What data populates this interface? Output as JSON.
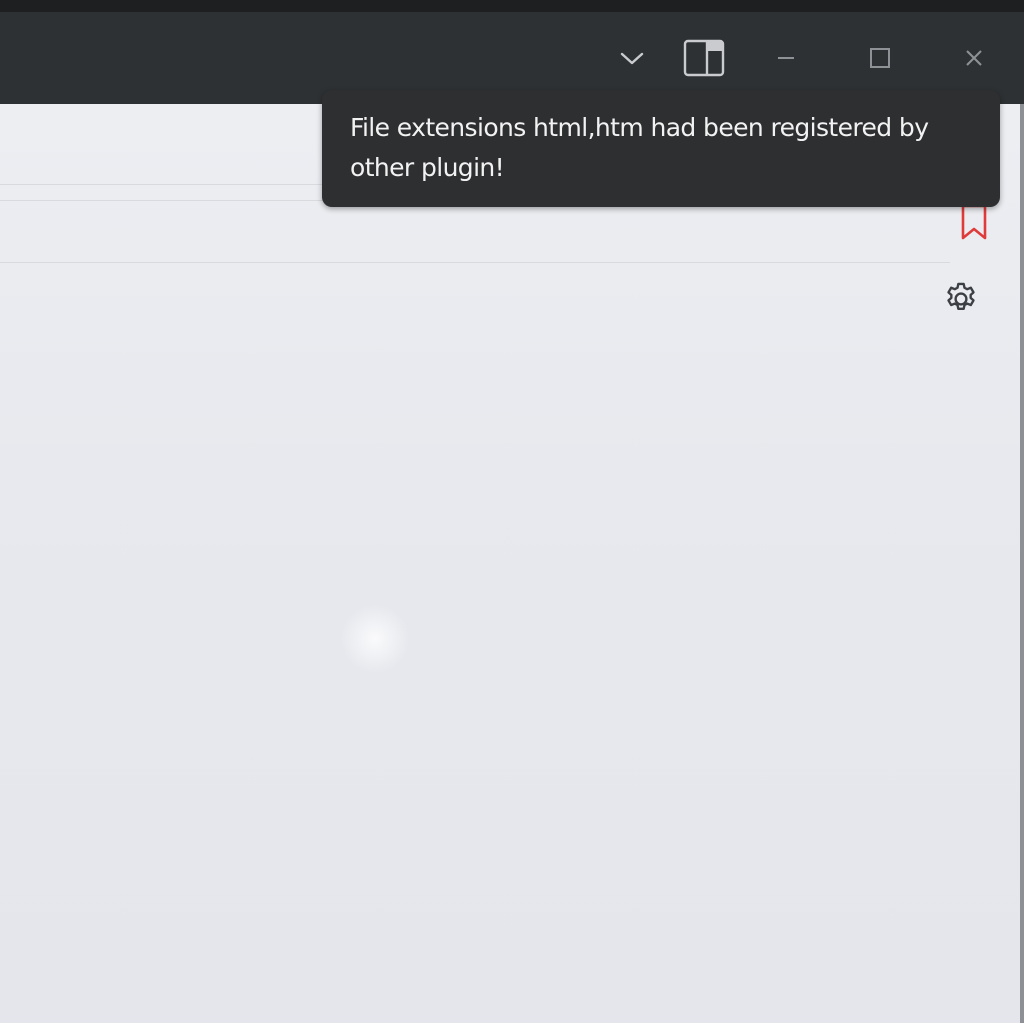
{
  "titlebar": {
    "buttons": [
      {
        "name": "dropdown-chevron-icon"
      },
      {
        "name": "split-view-icon"
      },
      {
        "name": "minimize-icon"
      },
      {
        "name": "maximize-icon"
      },
      {
        "name": "close-icon"
      }
    ]
  },
  "sidebar": {
    "icons": [
      {
        "name": "bookmark-icon",
        "color": "#e03b3b"
      },
      {
        "name": "gear-icon",
        "color": "#3c3f44"
      }
    ]
  },
  "notification": {
    "message": "File extensions html,htm had been registered by other plugin!"
  },
  "colors": {
    "titlebar_bg": "#2e3133",
    "content_bg": "#eceef2",
    "toast_bg": "#2d2f31",
    "toast_text": "#f2f2f2",
    "bookmark_accent": "#e03b3b"
  }
}
